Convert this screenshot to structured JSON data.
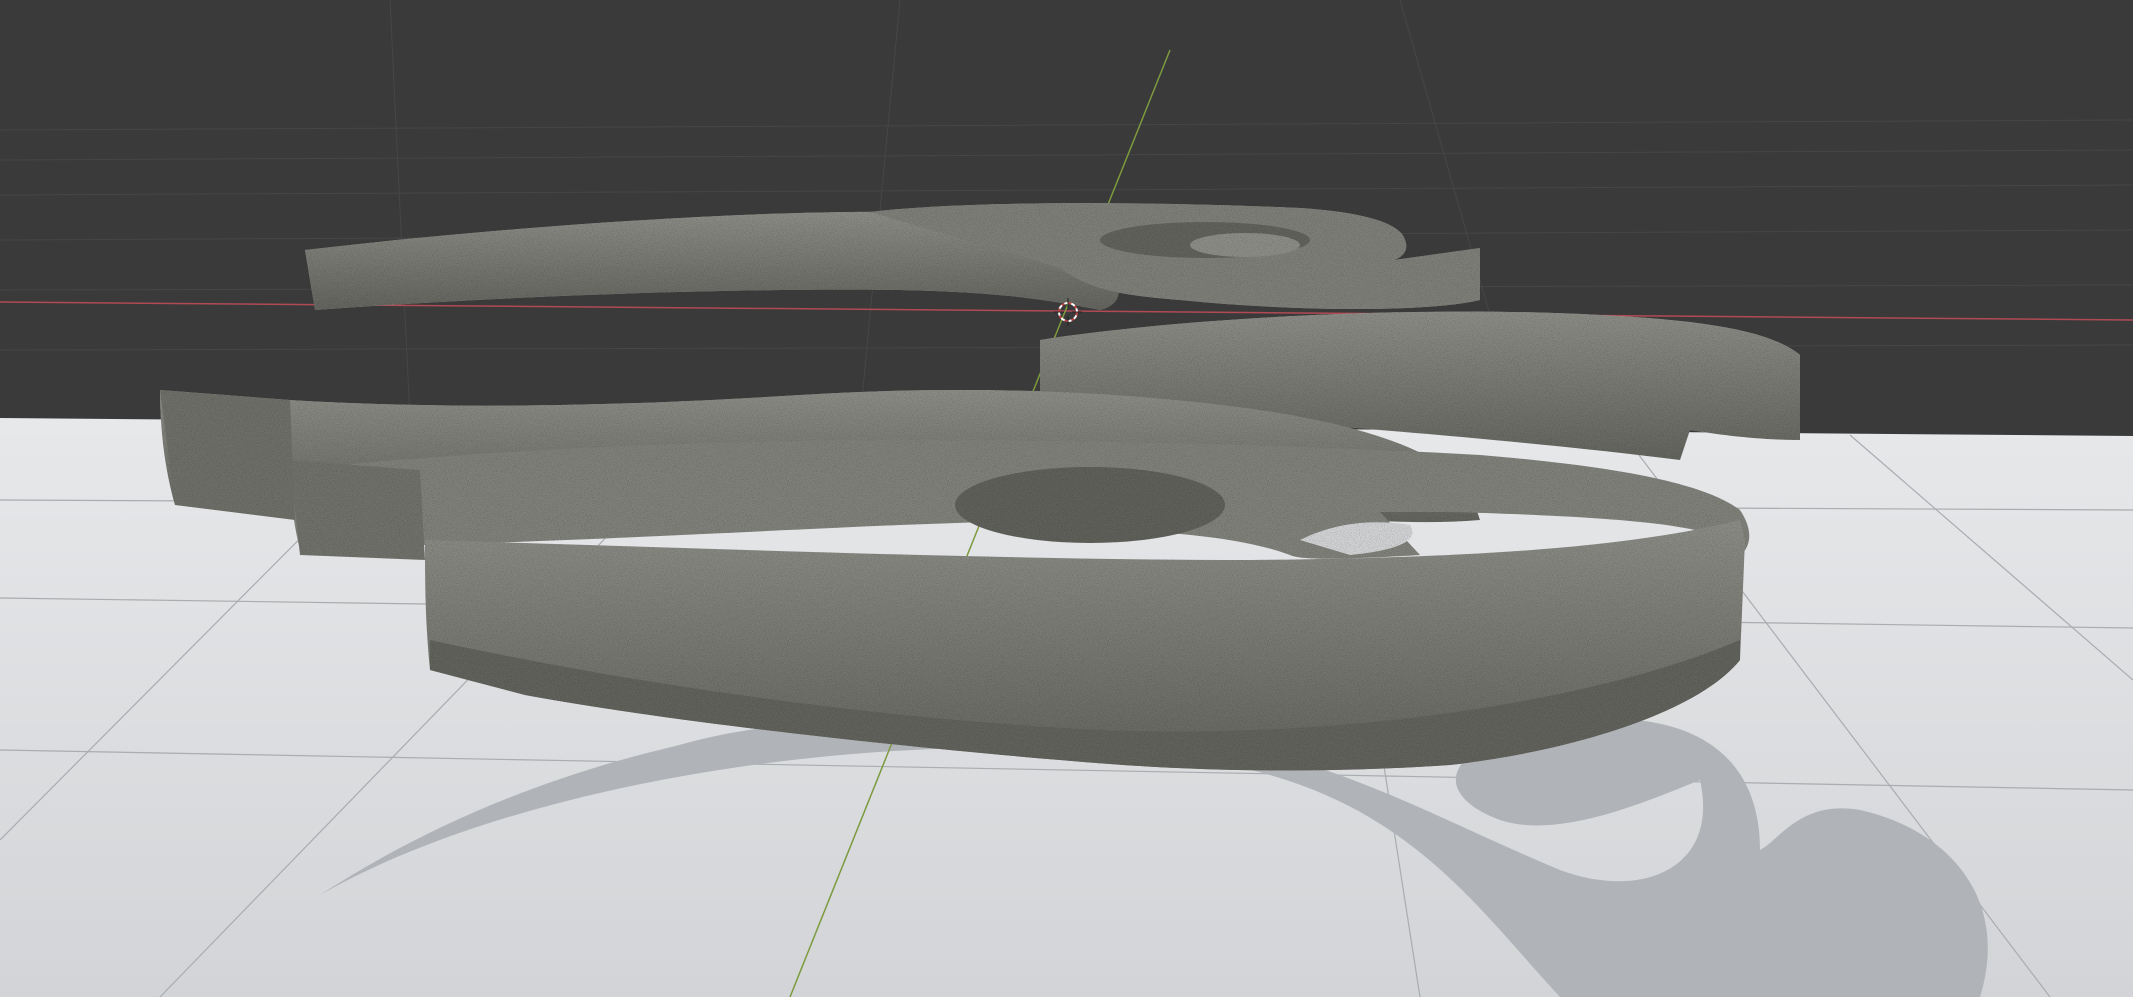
{
  "viewport": {
    "editor": "3d-viewport",
    "shading": "material-preview",
    "background_color": "#3a3a3a",
    "floor_color": "#dcdee0",
    "grid_line_color": "#4a4a4a",
    "x_axis_color": "#c0505a",
    "y_axis_color": "#7fa040",
    "model_color": "#8a8a84",
    "model_shadow_color": "#62625c",
    "shadow_color": "#a8abaf"
  },
  "scene": {
    "objects": [
      "noisy-extruded-emblem"
    ],
    "cursor_icon": "3d-cursor-icon"
  }
}
